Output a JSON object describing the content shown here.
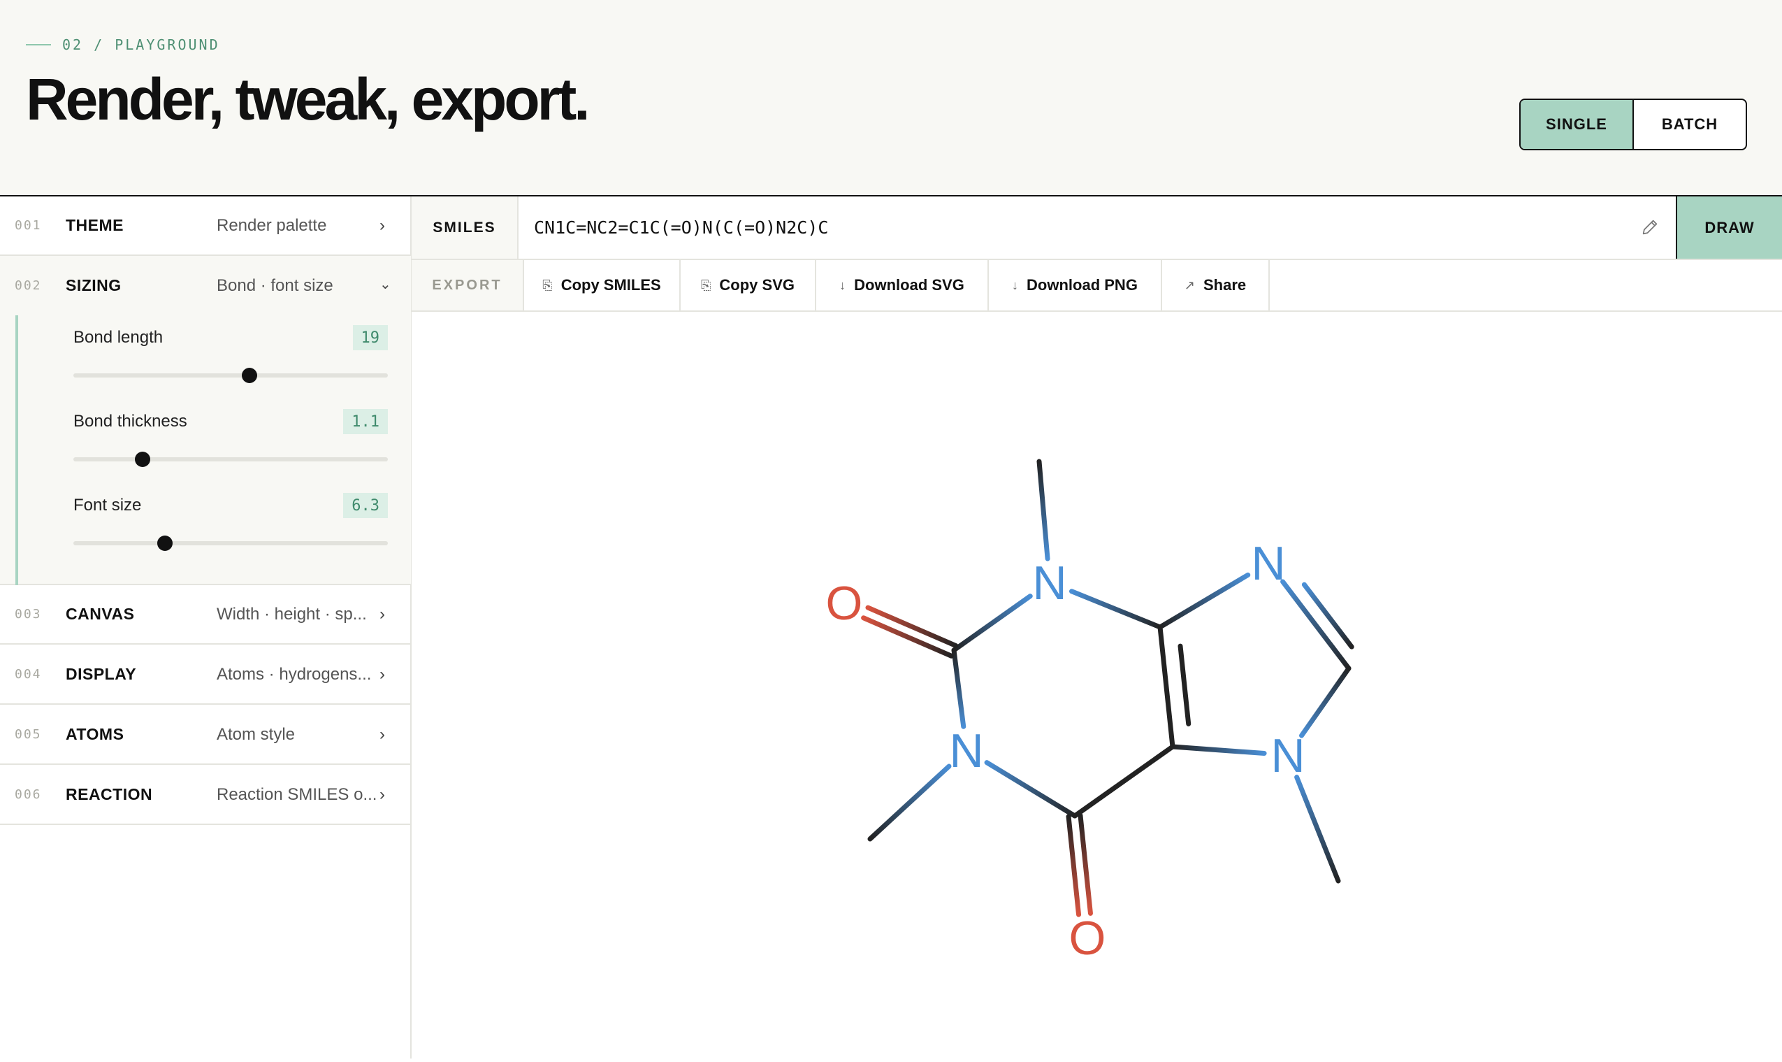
{
  "header": {
    "crumb": "02 / PLAYGROUND",
    "title": "Render, tweak, export.",
    "modes": [
      "SINGLE",
      "BATCH"
    ],
    "active_mode": "SINGLE"
  },
  "sidebar": {
    "items": [
      {
        "num": "001",
        "name": "THEME",
        "sub": "Render palette",
        "chev": "›"
      },
      {
        "num": "002",
        "name": "SIZING",
        "sub": "Bond · font size",
        "chev": "⌄"
      },
      {
        "num": "003",
        "name": "CANVAS",
        "sub": "Width · height · sp...",
        "chev": "›"
      },
      {
        "num": "004",
        "name": "DISPLAY",
        "sub": "Atoms · hydrogens...",
        "chev": "›"
      },
      {
        "num": "005",
        "name": "ATOMS",
        "sub": "Atom style",
        "chev": "›"
      },
      {
        "num": "006",
        "name": "REACTION",
        "sub": "Reaction SMILES o...",
        "chev": "›"
      }
    ],
    "sizing": {
      "controls": [
        {
          "label": "Bond length",
          "value": "19",
          "fraction": 0.56
        },
        {
          "label": "Bond thickness",
          "value": "1.1",
          "fraction": 0.22
        },
        {
          "label": "Font size",
          "value": "6.3",
          "fraction": 0.29
        }
      ]
    }
  },
  "smiles": {
    "label": "SMILES",
    "value": "CN1C=NC2=C1C(=O)N(C(=O)N2C)C",
    "draw_label": "DRAW",
    "pencil_icon": "pencil-icon"
  },
  "export": {
    "label": "EXPORT",
    "buttons": [
      {
        "icon": "⎘",
        "label": "Copy SMILES",
        "icon_name": "copy-icon"
      },
      {
        "icon": "⎘",
        "label": "Copy SVG",
        "icon_name": "copy-icon"
      },
      {
        "icon": "↓",
        "label": "Download SVG",
        "icon_name": "download-icon"
      },
      {
        "icon": "↓",
        "label": "Download PNG",
        "icon_name": "download-icon"
      },
      {
        "icon": "↗",
        "label": "Share",
        "icon_name": "share-icon"
      }
    ]
  },
  "molecule": {
    "atom_labels": [
      "N",
      "N",
      "N",
      "N",
      "O",
      "O"
    ],
    "colors": {
      "nitrogen": "#4a8fd6",
      "oxygen": "#d9533f",
      "carbon": "#222222",
      "accent": "#a8d4c2"
    }
  }
}
